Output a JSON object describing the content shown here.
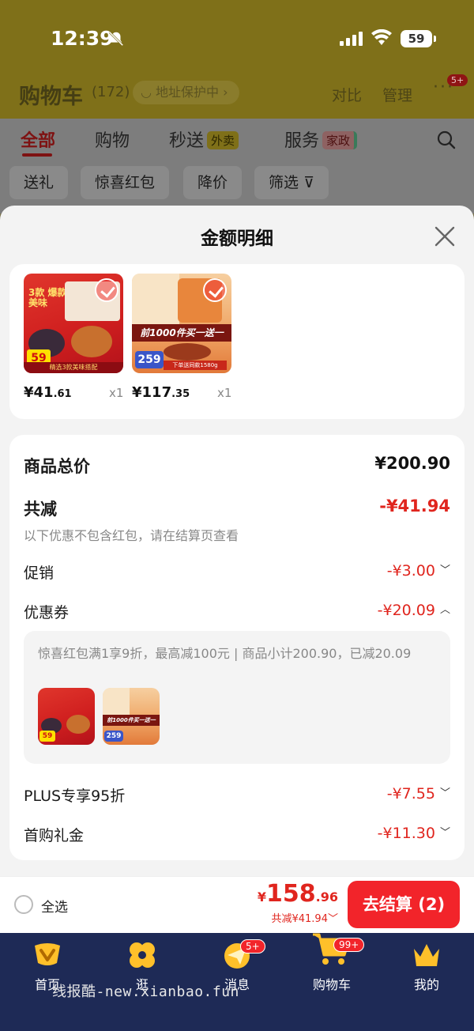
{
  "status_bar": {
    "time": "12:39",
    "battery": "59"
  },
  "cart_header": {
    "title": "购物车",
    "count": "(172)",
    "address_pill": "地址保护中",
    "compare": "对比",
    "manage": "管理",
    "more_badge": "5+"
  },
  "tabs": [
    {
      "label": "全部",
      "active": true
    },
    {
      "label": "购物"
    },
    {
      "label": "秒送",
      "tag": "外卖"
    },
    {
      "label": "服务",
      "tag": "家政"
    }
  ],
  "chips": [
    "送礼",
    "惊喜红包",
    "降价",
    "筛选"
  ],
  "sheet": {
    "title": "金额明细",
    "products": [
      {
        "price_int": "¥41",
        "price_dec": ".61",
        "qty": "x1",
        "tag_price": "59",
        "art_text": "3款 爆款美味",
        "strip": "精选3款美味搭配"
      },
      {
        "price_int": "¥117",
        "price_dec": ".35",
        "qty": "x1",
        "tag_price": "259",
        "art_text": "前1000件买一送一",
        "strip": "下单送同款1580g"
      }
    ],
    "rows": {
      "total_label": "商品总价",
      "total_value": "¥200.90",
      "discount_label": "共减",
      "discount_value": "-¥41.94",
      "discount_note": "以下优惠不包含红包，请在结算页查看",
      "promo_label": "促销",
      "promo_value": "-¥3.00",
      "coupon_label": "优惠券",
      "coupon_value": "-¥20.09",
      "coupon_detail": "惊喜红包满1享9折，最高减100元 | 商品小计200.90，已减20.09",
      "plus_label": "PLUS专享95折",
      "plus_value": "-¥7.55",
      "gift_label": "首购礼金",
      "gift_value": "-¥11.30"
    }
  },
  "checkout": {
    "select_all": "全选",
    "yen": "¥",
    "total_int": "158",
    "total_dec": ".96",
    "saved": "共减¥41.94",
    "button": "去结算 (2)"
  },
  "nav": [
    {
      "label": "首页",
      "icon": "home-icon"
    },
    {
      "label": "逛",
      "icon": "clover-icon"
    },
    {
      "label": "消息",
      "icon": "message-icon",
      "badge": "5+"
    },
    {
      "label": "购物车",
      "icon": "cart-icon",
      "badge": "99+"
    },
    {
      "label": "我的",
      "icon": "crown-icon"
    }
  ],
  "watermark": "线报酷-new.xianbao.fun",
  "colors": {
    "accent_red": "#f2242a",
    "price_red": "#e0251e",
    "nav_bg": "#1e2a56"
  }
}
